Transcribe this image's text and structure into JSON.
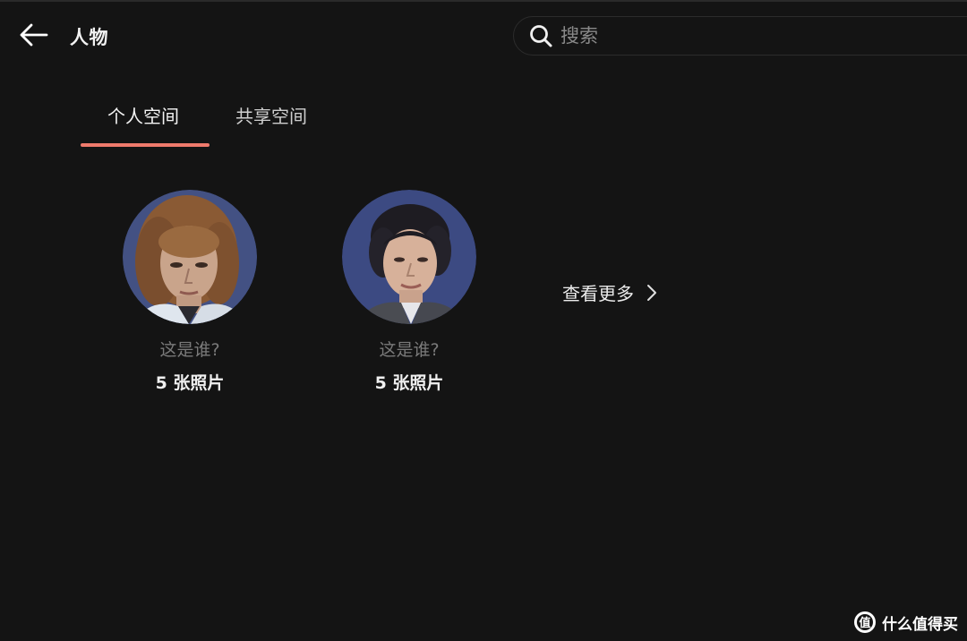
{
  "header": {
    "back_icon": "arrow-left-icon",
    "title": "人物",
    "search": {
      "icon": "search-icon",
      "placeholder": "搜索",
      "value": ""
    }
  },
  "tabs": [
    {
      "label": "个人空间",
      "active": true
    },
    {
      "label": "共享空间",
      "active": false
    }
  ],
  "accent_color": "#ef7a6c",
  "people": [
    {
      "label": "这是谁?",
      "count": "5 张照片"
    },
    {
      "label": "这是谁?",
      "count": "5 张照片"
    }
  ],
  "see_more": {
    "label": "查看更多",
    "icon": "chevron-right-icon"
  },
  "watermark": {
    "text": "什么值得买"
  }
}
